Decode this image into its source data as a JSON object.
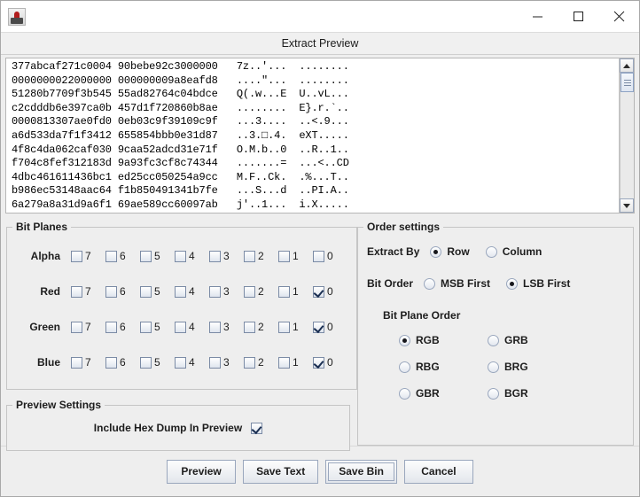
{
  "window": {
    "app_icon": "app-icon",
    "minimize_glyph": "minimize-icon",
    "maximize_glyph": "maximize-icon",
    "close_glyph": "close-icon",
    "subtitle": "Extract Preview"
  },
  "hex_preview": {
    "lines": [
      "377abcaf271c0004 90bebe92c3000000   7z..'...  ........",
      "0000000022000000 000000009a8eafd8   ....\"...  ........",
      "51280b7709f3b545 55ad82764c04bdce   Q(.w...E  U..vL...",
      "c2cdddb6e397ca0b 457d1f720860b8ae   ........  E}.r.`..",
      "0000813307ae0fd0 0eb03c9f39109c9f   ...3....  ..<.9...",
      "a6d533da7f1f3412 655854bbb0e31d87   ..3.□.4.  eXT.....",
      "4f8c4da062caf030 9caa52adcd31e71f   O.M.b..0  ..R..1..",
      "f704c8fef312183d 9a93fc3cf8c74344   .......=  ...<..CD",
      "4dbc461611436bc1 ed25cc050254a9cc   M.F..Ck.  .%...T..",
      "b986ec53148aac64 f1b850491341b7fe   ...S...d  ..PI.A..",
      "6a279a8a31d9a6f1 69ae589cc60097ab   j'..1...  i.X....."
    ]
  },
  "bit_planes": {
    "legend": "Bit Planes",
    "bit_labels": [
      "7",
      "6",
      "5",
      "4",
      "3",
      "2",
      "1",
      "0"
    ],
    "channels": [
      {
        "label": "Alpha",
        "checked": [
          false,
          false,
          false,
          false,
          false,
          false,
          false,
          false
        ]
      },
      {
        "label": "Red",
        "checked": [
          false,
          false,
          false,
          false,
          false,
          false,
          false,
          true
        ]
      },
      {
        "label": "Green",
        "checked": [
          false,
          false,
          false,
          false,
          false,
          false,
          false,
          true
        ]
      },
      {
        "label": "Blue",
        "checked": [
          false,
          false,
          false,
          false,
          false,
          false,
          false,
          true
        ]
      }
    ]
  },
  "preview_settings": {
    "legend": "Preview Settings",
    "include_hex_dump_label": "Include Hex Dump In Preview",
    "include_hex_dump_checked": true
  },
  "order_settings": {
    "legend": "Order settings",
    "extract_by": {
      "label": "Extract By",
      "options": [
        "Row",
        "Column"
      ],
      "selected": "Row"
    },
    "bit_order": {
      "label": "Bit Order",
      "options": [
        "MSB First",
        "LSB First"
      ],
      "selected": "LSB First"
    },
    "bit_plane_order": {
      "label": "Bit Plane Order",
      "options": [
        "RGB",
        "GRB",
        "RBG",
        "BRG",
        "GBR",
        "BGR"
      ],
      "selected": "RGB"
    }
  },
  "footer": {
    "buttons": [
      {
        "label": "Preview",
        "focused": false
      },
      {
        "label": "Save Text",
        "focused": false
      },
      {
        "label": "Save Bin",
        "focused": true
      },
      {
        "label": "Cancel",
        "focused": false
      }
    ]
  },
  "colors": {
    "window_bg": "#eeeeee",
    "panel_border": "#c5c5c5",
    "text": "#1d1d1d",
    "accent_border": "#9aa7bd"
  }
}
